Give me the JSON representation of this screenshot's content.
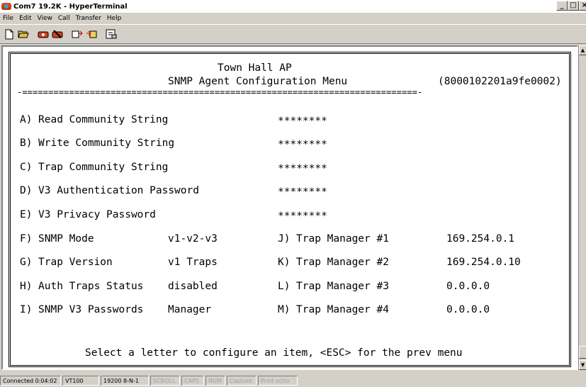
{
  "window": {
    "title": "Com7 19.2K - HyperTerminal",
    "controls": [
      "_",
      "□",
      "×"
    ]
  },
  "menu": [
    "File",
    "Edit",
    "View",
    "Call",
    "Transfer",
    "Help"
  ],
  "toolbar": {
    "buttons": [
      "new-icon",
      "open-icon",
      "connect-icon",
      "disconnect-icon",
      "send-icon",
      "receive-icon",
      "properties-icon"
    ]
  },
  "terminal": {
    "header_line1": "Town Hall AP",
    "header_menu": "SNMP Agent Configuration Menu",
    "header_id": "(8000102201a9fe0002)",
    "divider": "-============================================================================-",
    "items": [
      {
        "key": "A)",
        "label": "Read Community String",
        "value": "********"
      },
      {
        "key": "B)",
        "label": "Write Community String",
        "value": "********"
      },
      {
        "key": "C)",
        "label": "Trap Community String",
        "value": "********"
      },
      {
        "key": "D)",
        "label": "V3 Authentication Password",
        "value": "********"
      },
      {
        "key": "E)",
        "label": "V3 Privacy Password",
        "value": "********"
      }
    ],
    "pairs": [
      {
        "left_key": "F)",
        "left_label": "SNMP Mode",
        "left_value": "v1-v2-v3",
        "right_key": "J)",
        "right_label": "Trap Manager #1",
        "right_value": "169.254.0.1"
      },
      {
        "left_key": "G)",
        "left_label": "Trap Version",
        "left_value": "v1 Traps",
        "right_key": "K)",
        "right_label": "Trap Manager #2",
        "right_value": "169.254.0.10"
      },
      {
        "left_key": "H)",
        "left_label": "Auth Traps Status",
        "left_value": "disabled",
        "right_key": "L)",
        "right_label": "Trap Manager #3",
        "right_value": "0.0.0.0"
      },
      {
        "left_key": "I)",
        "left_label": "SNMP V3 Passwords",
        "left_value": "Manager",
        "right_key": "M)",
        "right_label": "Trap Manager #4",
        "right_value": "0.0.0.0"
      }
    ],
    "footer": "Select a letter to configure an item, <ESC> for the prev menu"
  },
  "status": {
    "connected": "Connected 0:04:02",
    "emulation": "VT100",
    "settings": "19200 8-N-1",
    "scroll": "SCROLL",
    "caps": "CAPS",
    "num": "NUM",
    "capture": "Capture",
    "print_echo": "Print echo"
  }
}
